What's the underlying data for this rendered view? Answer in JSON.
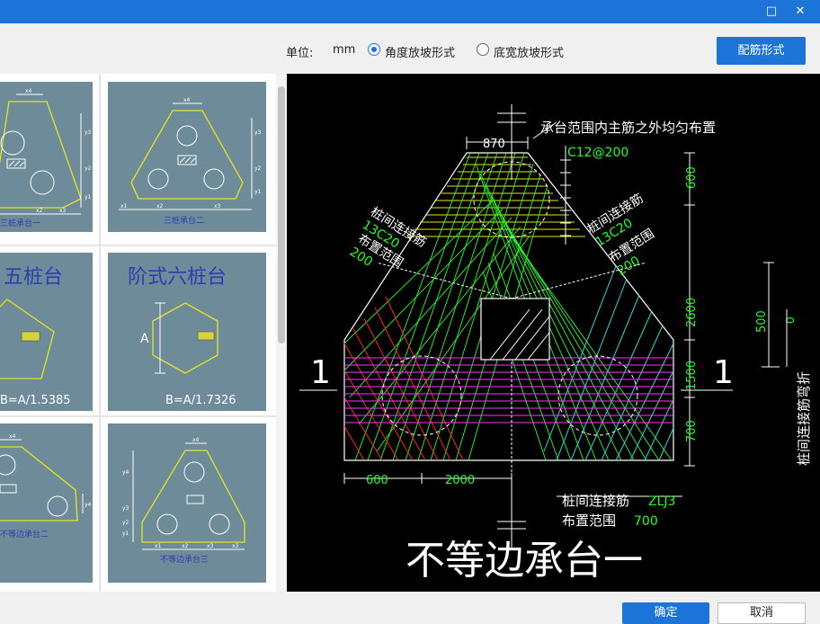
{
  "window": {
    "maximize_glyph": "□",
    "close_glyph": "✕"
  },
  "toolbar": {
    "unit_label": "单位:",
    "unit_value": "mm",
    "option_angle": "角度放坡形式",
    "option_width": "底宽放坡形式",
    "rebar_button": "配筋形式"
  },
  "gallery": {
    "cards": [
      {
        "label": "三桩承台一"
      },
      {
        "label": "三桩承台二"
      },
      {
        "title": "五桩台",
        "formula": "B=A/1.5385"
      },
      {
        "title": "阶式六桩台",
        "dim": "A",
        "formula": "B=A/1.7326"
      },
      {
        "label": "不等边承台二"
      },
      {
        "label": "不等边承台三"
      }
    ],
    "dims": {
      "x1": "x1",
      "x2": "x2",
      "x3": "x3",
      "x4": "x4",
      "y1": "y1",
      "y2": "y2",
      "y3": "y3",
      "y4": "y4"
    }
  },
  "drawing": {
    "title": "不等边承台一",
    "top_note": "承台范围内主筋之外均匀布置",
    "top_rebar": "C12@200",
    "dim_870": "870",
    "left_label1": "桩间连接筋",
    "left_label2": "13C20",
    "left_label3": "布置范围",
    "left_label4": "200",
    "right_label1": "桩间连接筋",
    "right_label2": "13C20",
    "right_label3": "布置范围",
    "right_label4": "200",
    "dim_600_right": "600",
    "dim_2600": "2600",
    "dim_1500": "1500",
    "dim_700_right": "700",
    "dim_500": "500",
    "dim_0": "0",
    "bend_label": "桩间连接筋弯折",
    "section_left": "1",
    "section_right": "1",
    "dim_600_bottom": "600",
    "dim_2000": "2000",
    "bottom_label1": "桩间连接筋",
    "bottom_rebar": "ZLJ3",
    "bottom_label2": "布置范围",
    "bottom_700": "700"
  },
  "footer": {
    "ok": "确定",
    "cancel": "取消"
  },
  "colors": {
    "accent": "#1c74d8",
    "card_bg": "#6e8b99",
    "outline": "#e6e61e",
    "green": "#22ff22",
    "magenta": "#ff33ff",
    "red": "#ff2222",
    "cyan": "#22dddd"
  }
}
